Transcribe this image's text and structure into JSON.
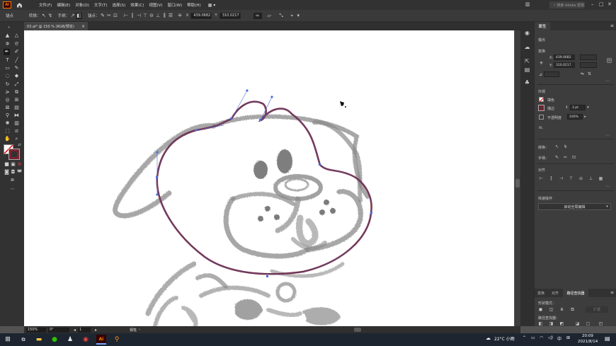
{
  "app": {
    "logo": "Ai",
    "search_placeholder": "搜索 Adobe 帮助"
  },
  "menu": [
    "文件(F)",
    "编辑(E)",
    "对象(O)",
    "文字(T)",
    "选择(S)",
    "效果(C)",
    "视图(V)",
    "窗口(W)",
    "帮助(H)"
  ],
  "control_bar": {
    "selection_label": "锚点",
    "convert_label": "转换：",
    "handles_label": "手柄：",
    "anchors_label": "锚点：",
    "x_label": "X",
    "x_value": "439.0682",
    "y_label": "Y",
    "y_value": "310.0217"
  },
  "document": {
    "tab_title": "03.ai* @ 150 % (RGB/预览)",
    "close": "×"
  },
  "status": {
    "zoom": "150%",
    "rotation": "0°",
    "artboard": "1",
    "tool": "钢笔"
  },
  "panel": {
    "title": "属性",
    "section_anchor": "锚点",
    "section_transform": "变换",
    "x_label": "X:",
    "x_value": "439.0682",
    "y_label": "Y:",
    "y_value": "310.0217",
    "section_appearance": "外观",
    "fill_label": "填色",
    "stroke_label": "描边",
    "stroke_value": "3 pt",
    "opacity_label": "不透明度",
    "opacity_value": "100%",
    "fx_label": "fx.",
    "convert_label": "转换：",
    "handles_label": "手柄：",
    "align_label": "对齐",
    "quick_actions_label": "快速操作",
    "quick_action_button": "启动全局编辑",
    "lower_tabs": [
      "变换",
      "对齐",
      "路径查找器"
    ],
    "shape_modes_label": "形状模式：",
    "expand_button": "扩展",
    "pathfinders_label": "路径查找器："
  },
  "taskbar": {
    "weather": "22°C 小雨",
    "ime": "中",
    "time": "20:09",
    "date": "2021/8/14"
  },
  "colors": {
    "accent": "#ff7c00",
    "path_stroke": "#7a2230",
    "sketch": "#808080"
  }
}
